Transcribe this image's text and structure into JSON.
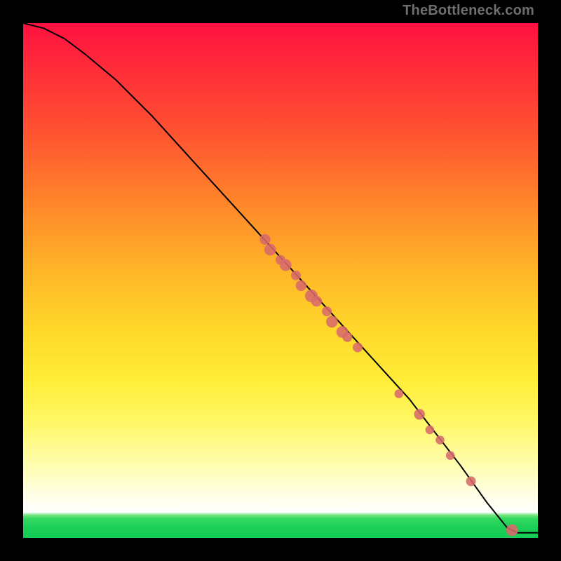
{
  "watermark": "TheBottleneck.com",
  "colors": {
    "frame_bg": "#000000",
    "curve": "#000000",
    "point": "#d86a6a",
    "gradient_top": "#ff1040",
    "gradient_bottom": "#15cc55"
  },
  "chart_data": {
    "type": "line",
    "title": "",
    "xlabel": "",
    "ylabel": "",
    "xlim": [
      0,
      100
    ],
    "ylim": [
      0,
      100
    ],
    "grid": false,
    "legend": false,
    "series": [
      {
        "name": "bottleneck-curve",
        "kind": "line",
        "x": [
          0,
          4,
          8,
          12,
          18,
          25,
          35,
          45,
          55,
          65,
          75,
          85,
          90,
          94,
          96,
          100
        ],
        "y": [
          100,
          99,
          97,
          94,
          89,
          82,
          71,
          60,
          49,
          38,
          27,
          14,
          7,
          2,
          1,
          1
        ]
      },
      {
        "name": "highlighted-points",
        "kind": "scatter",
        "points": [
          {
            "x": 47,
            "y": 58,
            "r": 1.1
          },
          {
            "x": 48,
            "y": 56,
            "r": 1.2
          },
          {
            "x": 50,
            "y": 54,
            "r": 1.0
          },
          {
            "x": 51,
            "y": 53,
            "r": 1.2
          },
          {
            "x": 53,
            "y": 51,
            "r": 1.0
          },
          {
            "x": 54,
            "y": 49,
            "r": 1.1
          },
          {
            "x": 56,
            "y": 47,
            "r": 1.3
          },
          {
            "x": 57,
            "y": 46,
            "r": 1.1
          },
          {
            "x": 59,
            "y": 44,
            "r": 1.0
          },
          {
            "x": 60,
            "y": 42,
            "r": 1.2
          },
          {
            "x": 62,
            "y": 40,
            "r": 1.2
          },
          {
            "x": 63,
            "y": 39,
            "r": 1.0
          },
          {
            "x": 65,
            "y": 37,
            "r": 1.0
          },
          {
            "x": 73,
            "y": 28,
            "r": 0.9
          },
          {
            "x": 77,
            "y": 24,
            "r": 1.1
          },
          {
            "x": 79,
            "y": 21,
            "r": 0.9
          },
          {
            "x": 81,
            "y": 19,
            "r": 0.9
          },
          {
            "x": 83,
            "y": 16,
            "r": 0.9
          },
          {
            "x": 87,
            "y": 11,
            "r": 1.0
          },
          {
            "x": 95,
            "y": 1.5,
            "r": 1.2
          }
        ]
      }
    ]
  }
}
